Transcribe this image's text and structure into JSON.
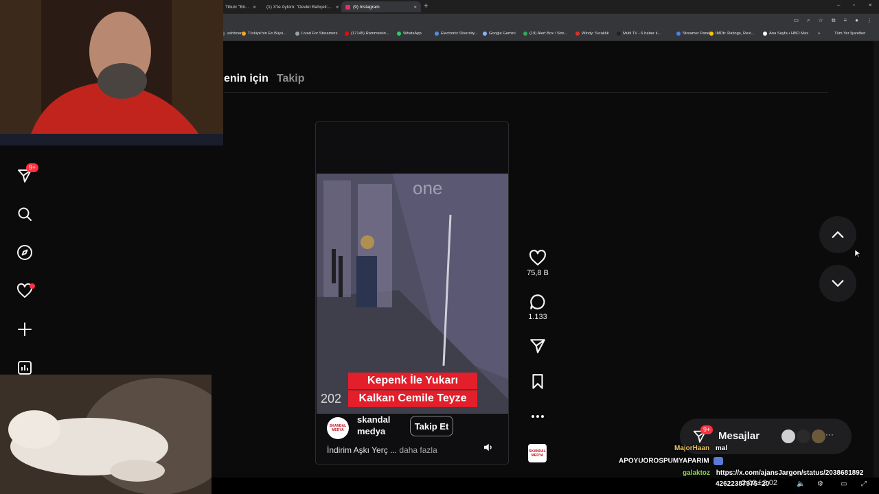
{
  "browser": {
    "tabs": [
      {
        "label": "Tibulc \"Bir...",
        "favicon_color": "#9aa0a6"
      },
      {
        "label": "(1) X'te Aylom: \"Devlet Bahçeli:...",
        "favicon_color": "#ffffff"
      },
      {
        "label": "(9) Instagram",
        "favicon_color": "#e1306c"
      }
    ],
    "new_tab_label": "+",
    "window_controls": [
      "–",
      "▫",
      "×"
    ],
    "bookmarks": [
      {
        "label": "ashboard",
        "color": "#5f6368"
      },
      {
        "label": "Türkiye'nin En Büyü...",
        "color": "#f5a623"
      },
      {
        "label": "Livad For Streamers",
        "color": "#9aa0a6"
      },
      {
        "label": "(17145) Rammstein...",
        "color": "#ff0000"
      },
      {
        "label": "WhatsApp",
        "color": "#25d366"
      },
      {
        "label": "Electronic Diversity...",
        "color": "#4a90e2"
      },
      {
        "label": "Google Gemini",
        "color": "#8ab4f8"
      },
      {
        "label": "(19) Alert Box / Stre...",
        "color": "#34a853"
      },
      {
        "label": "Windy: Sıcaklık",
        "color": "#d93025"
      },
      {
        "label": "Multi TV - 6 haber k...",
        "color": "#222222"
      },
      {
        "label": "Streamer Panel",
        "color": "#4285f4"
      },
      {
        "label": "IMDb: Ratings, Revi...",
        "color": "#f5c518"
      },
      {
        "label": "Ana Sayfa • HBO Max",
        "color": "#ffffff"
      }
    ],
    "bookmarks_more": "»",
    "all_bookmarks": "Tüm Yer İşaretleri"
  },
  "feed": {
    "tabs": [
      {
        "label": "enin için",
        "active": true
      },
      {
        "label": "Takip",
        "active": false
      }
    ]
  },
  "sidebar": {
    "notifications_badge": "9+",
    "items": [
      "messages",
      "search",
      "explore",
      "notifications",
      "create",
      "dashboard"
    ]
  },
  "reel": {
    "caption_line1": "Kepenk İle Yukarı",
    "caption_line2": "Kalkan Cemile Teyze",
    "year_overlay": "202",
    "video_sign": "one",
    "account_avatar_text": "SKANDAL MEDYA",
    "account_name": "skandal medya",
    "follow_label": "Takip Et",
    "description": "İndirim Aşkı Yerç",
    "ellipsis": " ... ",
    "more_label": "daha fazla",
    "likes": "75,8 B",
    "comments": "1.133",
    "audio_avatar_text": "SKANDAL MEDYA"
  },
  "navigation": {
    "up_label": "previous",
    "down_label": "next"
  },
  "messages_bar": {
    "badge": "9+",
    "label": "Mesajlar",
    "more": "···"
  },
  "chat": [
    {
      "user": "MajorHaan",
      "user_color": "#f0c75e",
      "text": "mal"
    },
    {
      "user": "",
      "user_color": "#ffffff",
      "text": "APOYUOROSPUMYAPARIM"
    },
    {
      "user": "galaktoz",
      "user_color": "#8fd14f",
      "text": "https://x.com/ajansJargon/status/2038681892"
    },
    {
      "user": "",
      "user_color": "#ffffff",
      "text": "42622387975=20"
    }
  ],
  "player": {
    "time": "2:02 / 2:02"
  }
}
